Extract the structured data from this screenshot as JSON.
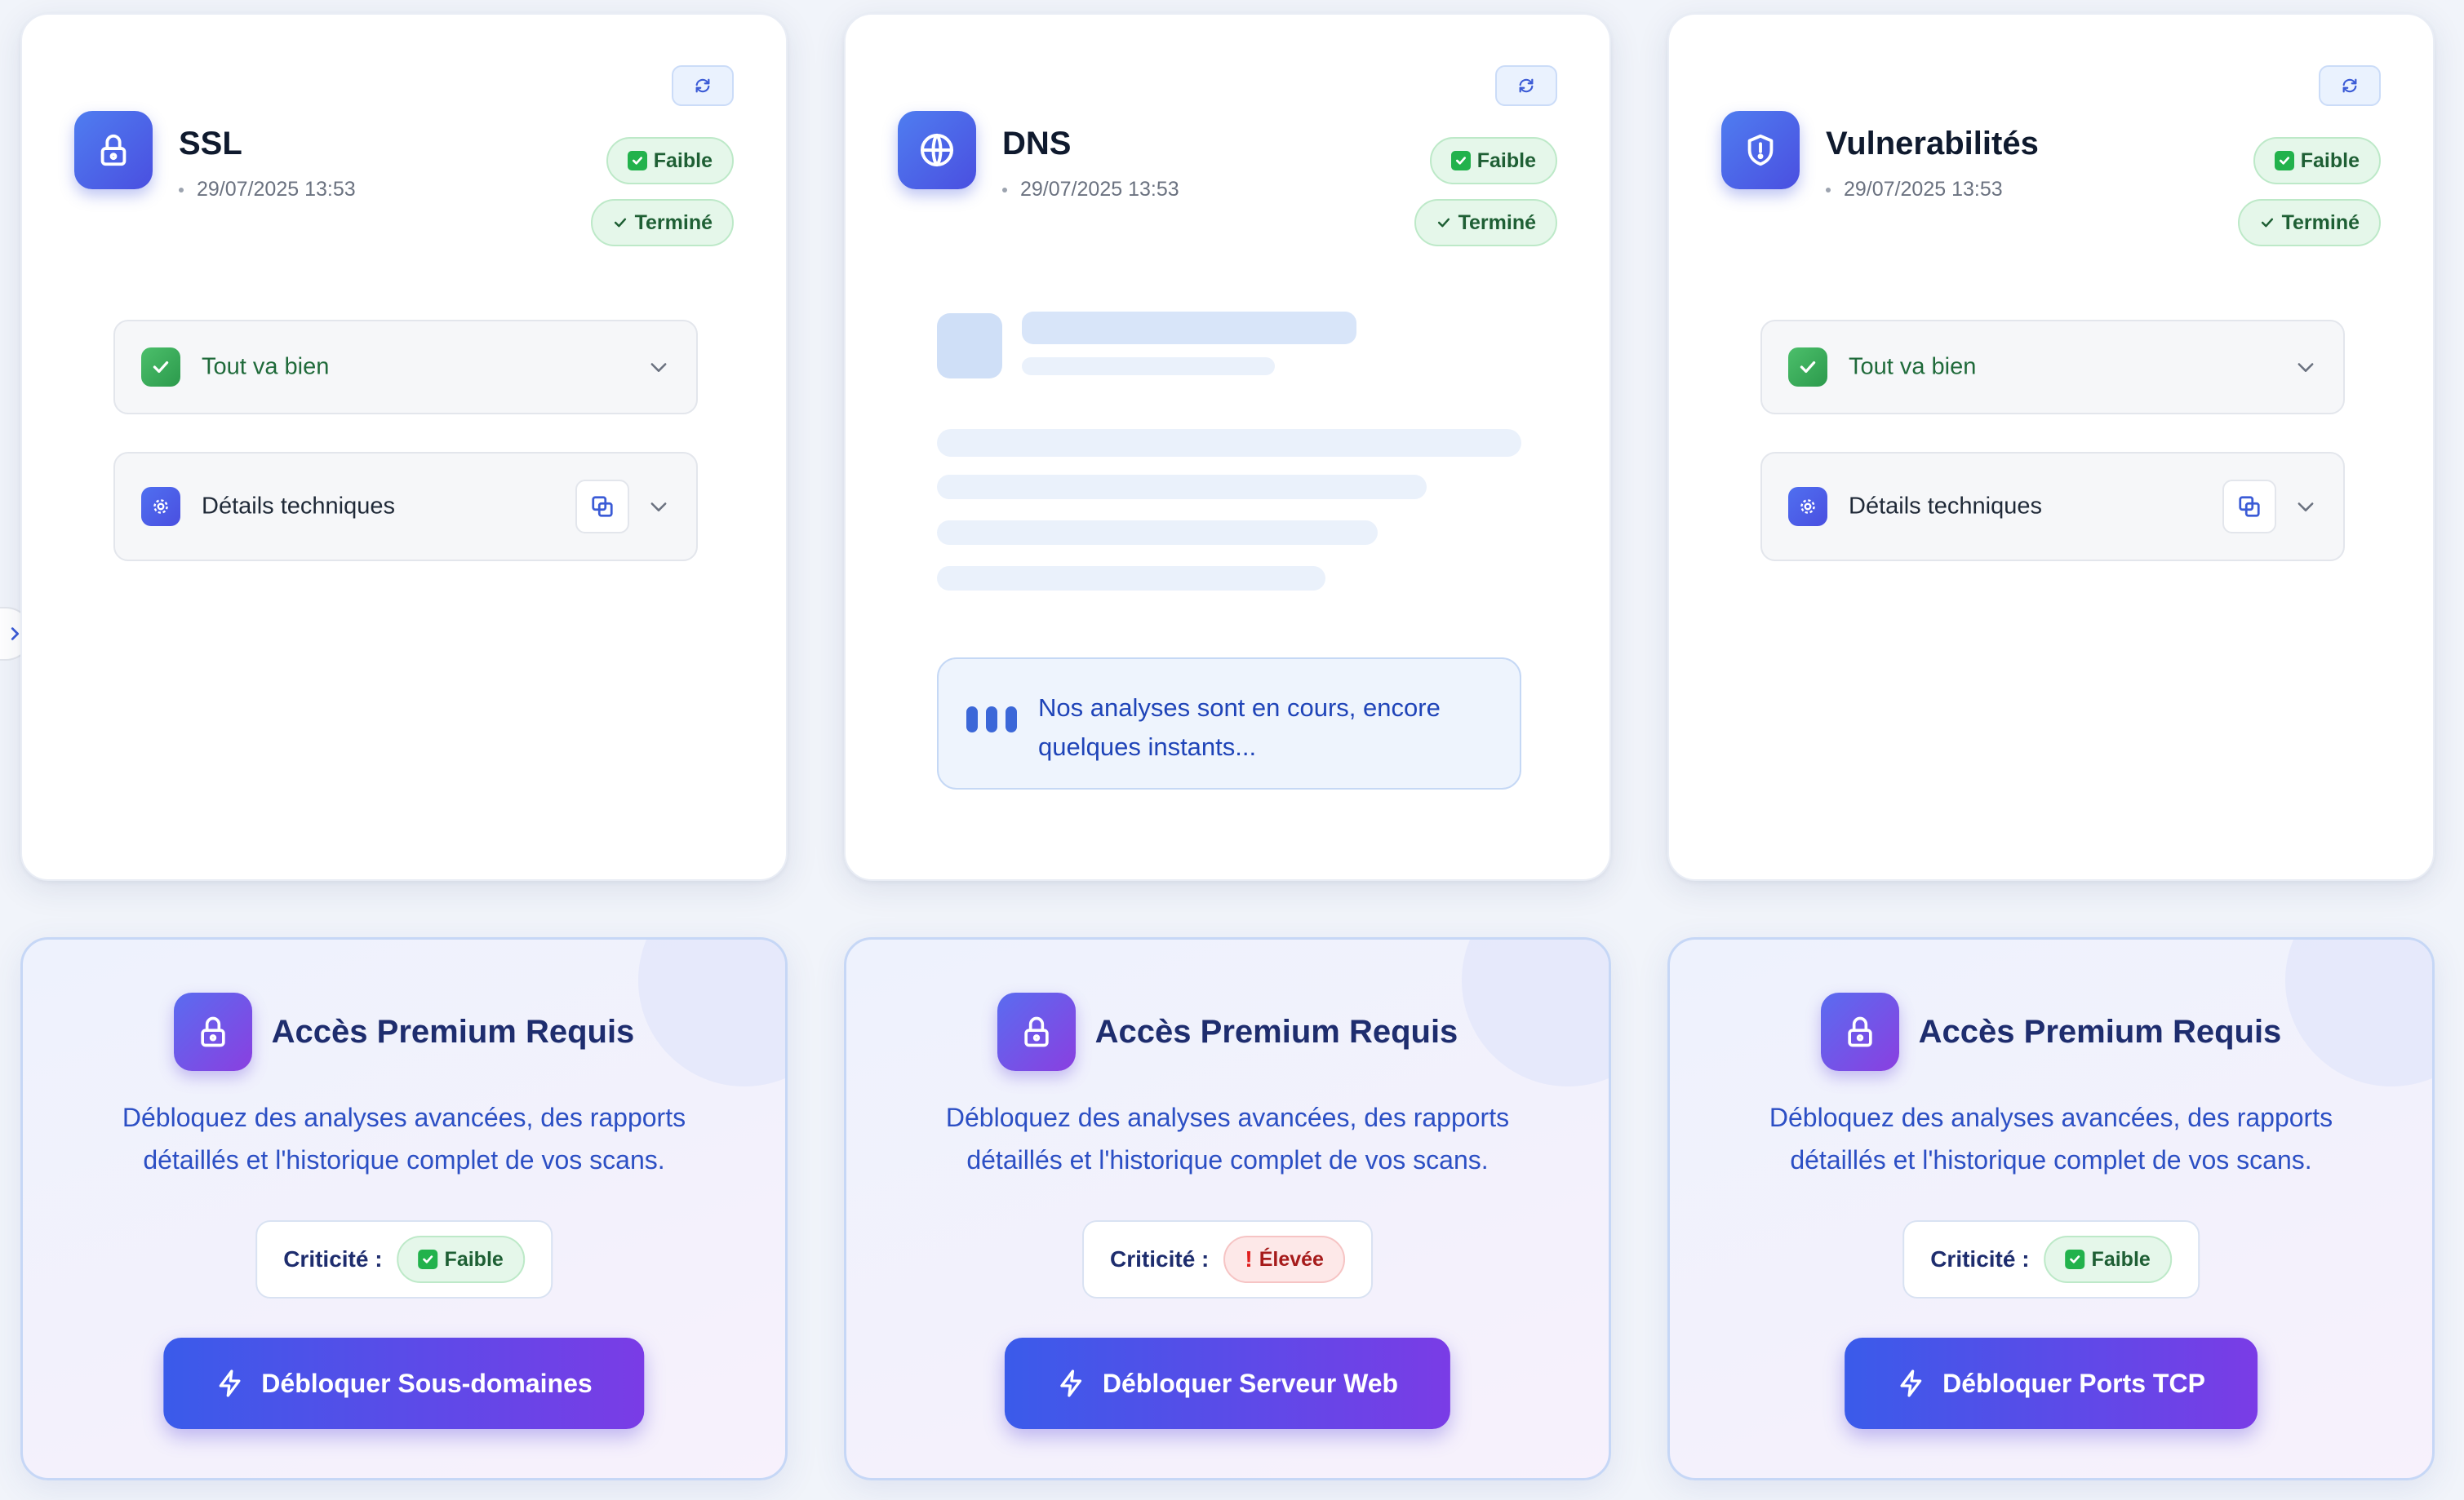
{
  "scan_cards": [
    {
      "title": "SSL",
      "date": "29/07/2025 13:53",
      "level": "Faible",
      "status": "Terminé",
      "icon": "lock-icon",
      "state": "done",
      "summary": "Tout va bien",
      "details": "Détails techniques"
    },
    {
      "title": "DNS",
      "date": "29/07/2025 13:53",
      "level": "Faible",
      "status": "Terminé",
      "icon": "globe-icon",
      "state": "loading",
      "loading_message": "Nos analyses sont en cours, encore quelques instants..."
    },
    {
      "title": "Vulnerabilités",
      "date": "29/07/2025 13:53",
      "level": "Faible",
      "status": "Terminé",
      "icon": "shield-icon",
      "state": "done",
      "summary": "Tout va bien",
      "details": "Détails techniques"
    }
  ],
  "premium_cards": [
    {
      "title": "Accès Premium Requis",
      "description": "Débloquez des analyses avancées, des rapports détaillés et l'historique complet de vos scans.",
      "criticality_label": "Criticité :",
      "criticality": "Faible",
      "criticality_kind": "low",
      "button": "Débloquer Sous-domaines"
    },
    {
      "title": "Accès Premium Requis",
      "description": "Débloquez des analyses avancées, des rapports détaillés et l'historique complet de vos scans.",
      "criticality_label": "Criticité :",
      "criticality": "Élevée",
      "criticality_kind": "high",
      "button": "Débloquer Serveur Web"
    },
    {
      "title": "Accès Premium Requis",
      "description": "Débloquez des analyses avancées, des rapports détaillés et l'historique complet de vos scans.",
      "criticality_label": "Criticité :",
      "criticality": "Faible",
      "criticality_kind": "low",
      "button": "Débloquer Ports TCP"
    }
  ],
  "colors": {
    "accent": "#4a4fe0",
    "success": "#22b24c",
    "danger": "#e11d1d",
    "premium_gradient_start": "#3a5bea",
    "premium_gradient_end": "#7a3ce6"
  }
}
